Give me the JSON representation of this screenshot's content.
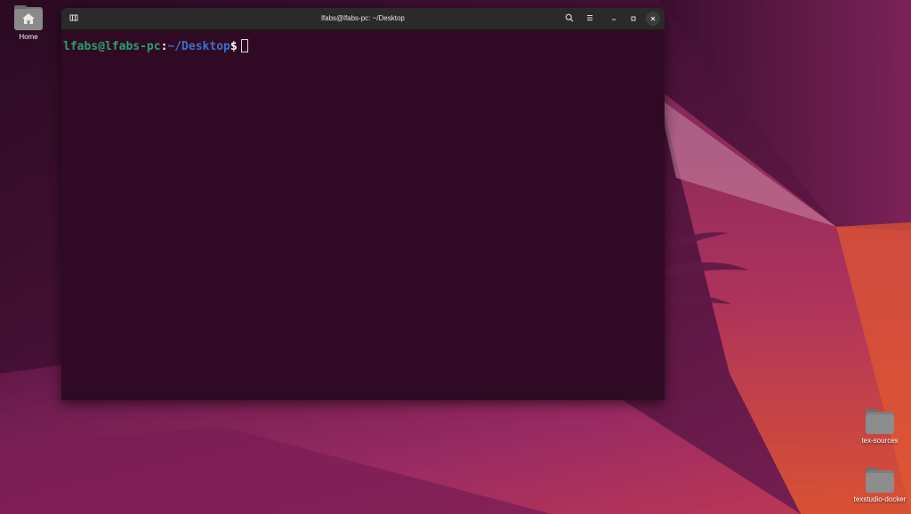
{
  "desktop": {
    "wallpaper_colors": {
      "dark": "#2c0b24",
      "plum": "#5a1745",
      "magenta": "#9a2a67",
      "orange": "#e45a32"
    },
    "icons": [
      {
        "label": "Home",
        "icon": "home-folder-icon"
      },
      {
        "label": "tex-sources",
        "icon": "folder-icon"
      },
      {
        "label": "texstudio-docker",
        "icon": "folder-icon"
      }
    ]
  },
  "terminal": {
    "title": "lfabs@lfabs-pc: ~/Desktop",
    "buttons": {
      "new_tab": "new-tab-icon",
      "search": "search-icon",
      "menu": "hamburger-menu-icon",
      "minimize": "minimize-icon",
      "maximize": "maximize-icon",
      "close": "close-icon"
    },
    "prompt": {
      "user_host": "lfabs@lfabs-pc",
      "colon": ":",
      "path": "~/Desktop",
      "symbol": "$"
    },
    "colors": {
      "background": "#300a24",
      "titlebar": "#2a2a2a",
      "user_host": "#26a269",
      "path": "#3b6fc6"
    }
  }
}
